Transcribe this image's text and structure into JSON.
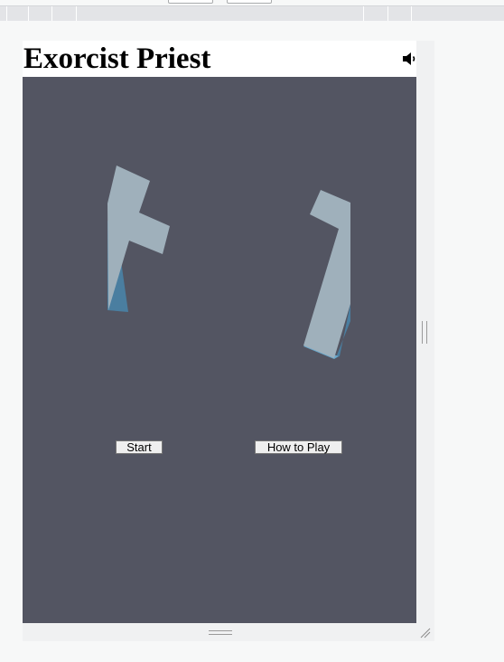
{
  "game": {
    "title": "Exorcist Priest",
    "sound_icon": "speaker-volume-icon",
    "buttons": {
      "start_label": "Start",
      "how_to_play_label": "How to Play"
    }
  },
  "colors": {
    "canvas_background": "#535562",
    "sprite_fill": "#9fb0bb",
    "sprite_shadow": "#4a7ea0",
    "toolbar": "#e3e4e7",
    "frame": "#f0f1f2"
  }
}
